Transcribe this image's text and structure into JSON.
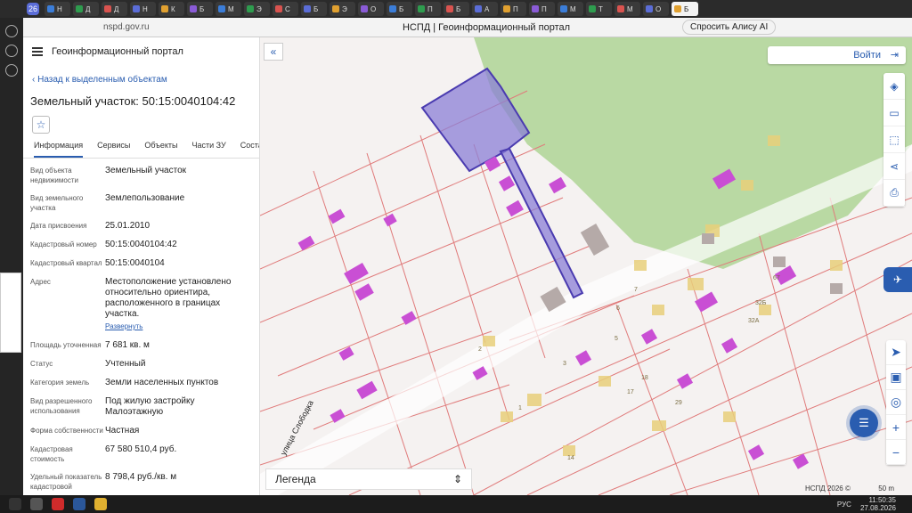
{
  "browser": {
    "tab_count": "26",
    "tabs": [
      {
        "label": "H"
      },
      {
        "label": "Д"
      },
      {
        "label": "Д"
      },
      {
        "label": "Н"
      },
      {
        "label": "К"
      },
      {
        "label": "Б"
      },
      {
        "label": "М"
      },
      {
        "label": "Э"
      },
      {
        "label": "С"
      },
      {
        "label": "Б"
      },
      {
        "label": "Э"
      },
      {
        "label": "О"
      },
      {
        "label": "Б"
      },
      {
        "label": "П"
      },
      {
        "label": "Б"
      },
      {
        "label": "А"
      },
      {
        "label": "П"
      },
      {
        "label": "П"
      },
      {
        "label": "М"
      },
      {
        "label": "Т"
      },
      {
        "label": "М"
      },
      {
        "label": "О"
      },
      {
        "label": "Б"
      }
    ],
    "url": "nspd.gov.ru",
    "page_title": "НСПД | Геоинформационный портал",
    "alice_label": "Спросить Алису AI"
  },
  "panel": {
    "portal_name": "Геоинформационный портал",
    "back_label": "Назад к выделенным объектам",
    "object_title": "Земельный участок: 50:15:0040104:42",
    "star_icon": "star-icon",
    "tabs": [
      "Информация",
      "Сервисы",
      "Объекты",
      "Части ЗУ",
      "Состав"
    ],
    "active_tab": "Информация",
    "properties": [
      {
        "key": "Вид объекта недвижимости",
        "value": "Земельный участок"
      },
      {
        "key": "Вид земельного участка",
        "value": "Землепользование"
      },
      {
        "key": "Дата присвоения",
        "value": "25.01.2010"
      },
      {
        "key": "Кадастровый номер",
        "value": "50:15:0040104:42"
      },
      {
        "key": "Кадастровый квартал",
        "value": "50:15:0040104"
      },
      {
        "key": "Адрес",
        "value": "Местоположение установлено относительно ориентира, расположенного в границах участка."
      },
      {
        "key": "Площадь уточненная",
        "value": "7 681 кв. м"
      },
      {
        "key": "Статус",
        "value": "Учтенный"
      },
      {
        "key": "Категория земель",
        "value": "Земли населенных пунктов"
      },
      {
        "key": "Вид разрешенного использования",
        "value": "Под жилую застройку Малоэтажную"
      },
      {
        "key": "Форма собственности",
        "value": "Частная"
      },
      {
        "key": "Кадастровая стоимость",
        "value": "67 580 510,4 руб."
      },
      {
        "key": "Удельный показатель кадастровой",
        "value": "8 798,4 руб./кв. м"
      }
    ],
    "expand_label": "Развернуть"
  },
  "map": {
    "login_label": "Войти",
    "legend_label": "Легенда",
    "street_label": "улица Слободка",
    "copyright": "НСПД 2026 ©",
    "scale": "50 m",
    "house_numbers": [
      "7",
      "6",
      "5",
      "3",
      "2",
      "1",
      "17",
      "18",
      "29",
      "14",
      "32Б",
      "32А",
      "67"
    ],
    "colors": {
      "parcel_border": "#e07b7b",
      "selected_fill": "#8b7fd6",
      "selected_border": "#4a3bb0",
      "building": "#c94fd4",
      "green_zone": "#b9d9a3",
      "accent": "#2a5db0"
    },
    "tools": [
      "layers-icon",
      "ruler-icon",
      "select-area-icon",
      "share-icon",
      "print-icon"
    ],
    "zoom_tools": [
      "locate-icon",
      "map-type-icon",
      "geolocation-icon",
      "zoom-in-icon",
      "zoom-out-icon"
    ],
    "zoom_symbols": [
      "➤",
      "▣",
      "◎",
      "+",
      "−"
    ]
  },
  "taskbar": {
    "time": "11:50:35",
    "date": "27.08.2026",
    "lang": "РУС"
  }
}
